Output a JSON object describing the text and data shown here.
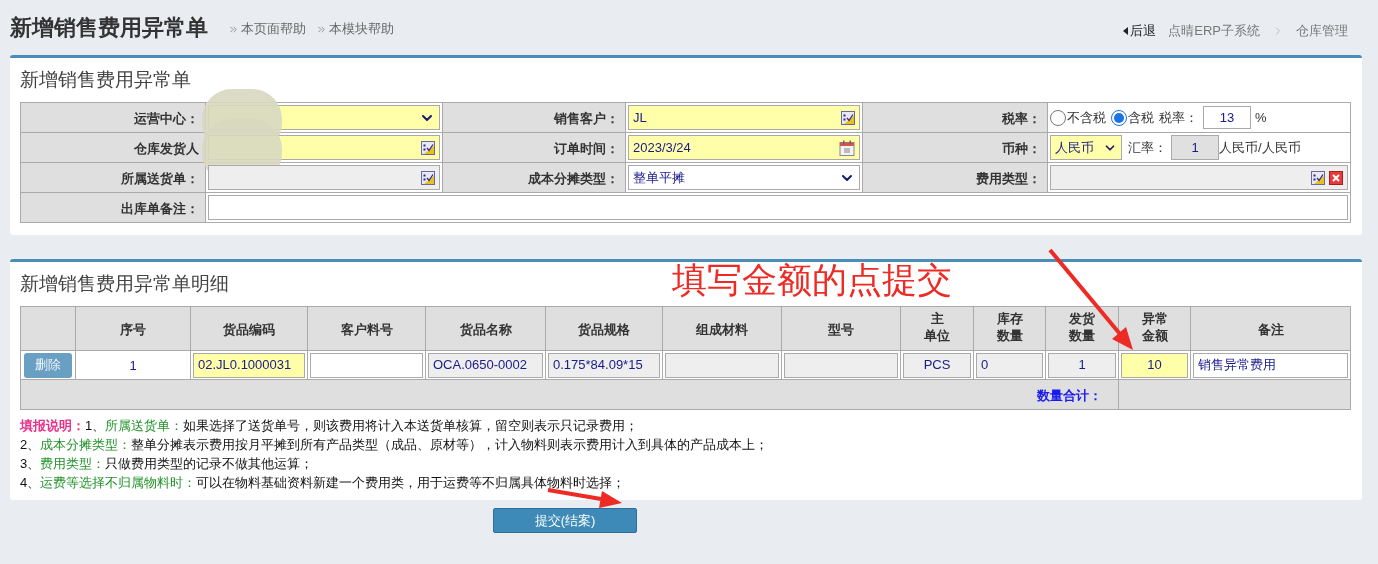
{
  "header": {
    "title": "新增销售费用异常单",
    "help_links": [
      "本页面帮助",
      "本模块帮助"
    ],
    "back": "后退",
    "breadcrumb": [
      "点晴ERP子系统",
      "仓库管理"
    ]
  },
  "form": {
    "title": "新增销售费用异常单",
    "rows": [
      [
        {
          "label": "运营中心：",
          "kind": "select",
          "required": true,
          "redacted": true
        },
        {
          "label": "销售客户：",
          "kind": "lookup",
          "value": "JL",
          "required": true
        },
        {
          "label": "税率：",
          "kind": "tax",
          "options": [
            {
              "label": "不含税",
              "selected": false
            },
            {
              "label": "含税",
              "selected": true
            }
          ],
          "rate_label": "税率：",
          "rate": "13",
          "unit": "%"
        }
      ],
      [
        {
          "label": "仓库发货人",
          "kind": "lookup",
          "required": true,
          "redacted": true
        },
        {
          "label": "订单时间：",
          "kind": "date",
          "value": "2023/3/24",
          "required": true
        },
        {
          "label": "币种：",
          "kind": "currency",
          "value": "人民币",
          "required": true,
          "rate_label": "汇率：",
          "rate": "1",
          "unit": "人民币/人民币"
        }
      ],
      [
        {
          "label": "所属送货单：",
          "kind": "lookup",
          "disabled": true
        },
        {
          "label": "成本分摊类型：",
          "kind": "select",
          "value": "整单平摊"
        },
        {
          "label": "费用类型：",
          "kind": "lookup-clear",
          "disabled": true
        }
      ],
      [
        {
          "label": "出库单备注：",
          "kind": "text"
        }
      ]
    ]
  },
  "detail": {
    "title": "新增销售费用异常单明细",
    "columns": [
      null,
      "序号",
      "货品编码",
      "客户料号",
      "货品名称",
      "货品规格",
      "组成材料",
      "型号",
      "主单位",
      "库存数量",
      "发货数量",
      "异常金额",
      "备注"
    ],
    "rows": [
      [
        {
          "kind": "button",
          "value": "删除",
          "disabled": true
        },
        {
          "kind": "text",
          "value": "1"
        },
        {
          "kind": "input",
          "value": "02.JL0.1000031",
          "required": true
        },
        {
          "kind": "input"
        },
        {
          "kind": "input",
          "value": "OCA.0650-0002",
          "disabled": true
        },
        {
          "kind": "input",
          "value": "0.175*84.09*15",
          "disabled": true
        },
        {
          "kind": "input",
          "disabled": true
        },
        {
          "kind": "input",
          "disabled": true
        },
        {
          "kind": "input",
          "value": "PCS",
          "disabled": true
        },
        {
          "kind": "input",
          "value": "0",
          "disabled": true
        },
        {
          "kind": "input",
          "value": "1",
          "disabled": true
        },
        {
          "kind": "input",
          "value": "10",
          "required": true
        },
        {
          "kind": "input",
          "value": "销售异常费用"
        }
      ]
    ],
    "total_label": "数量合计："
  },
  "notes": [
    {
      "intro": "填报说明：",
      "number": "1、",
      "keyword": "所属送货单：",
      "text": "如果选择了送货单号，则该费用将计入本送货单核算，留空则表示只记录费用；"
    },
    {
      "number": "2、",
      "keyword": "成本分摊类型：",
      "text": "整单分摊表示费用按月平摊到所有产品类型（成品、原材等），计入物料则表示费用计入到具体的产品成本上；"
    },
    {
      "number": "3、",
      "keyword": "费用类型：",
      "text": "只做费用类型的记录不做其他运算；"
    },
    {
      "number": "4、",
      "keyword": "运费等选择不归属物料时：",
      "text": "可以在物料基础资料新建一个费用类，用于运费等不归属具体物料时选择；"
    }
  ],
  "submit": "提交(结案)",
  "annotation": {
    "text": "填写金额的点提交"
  }
}
